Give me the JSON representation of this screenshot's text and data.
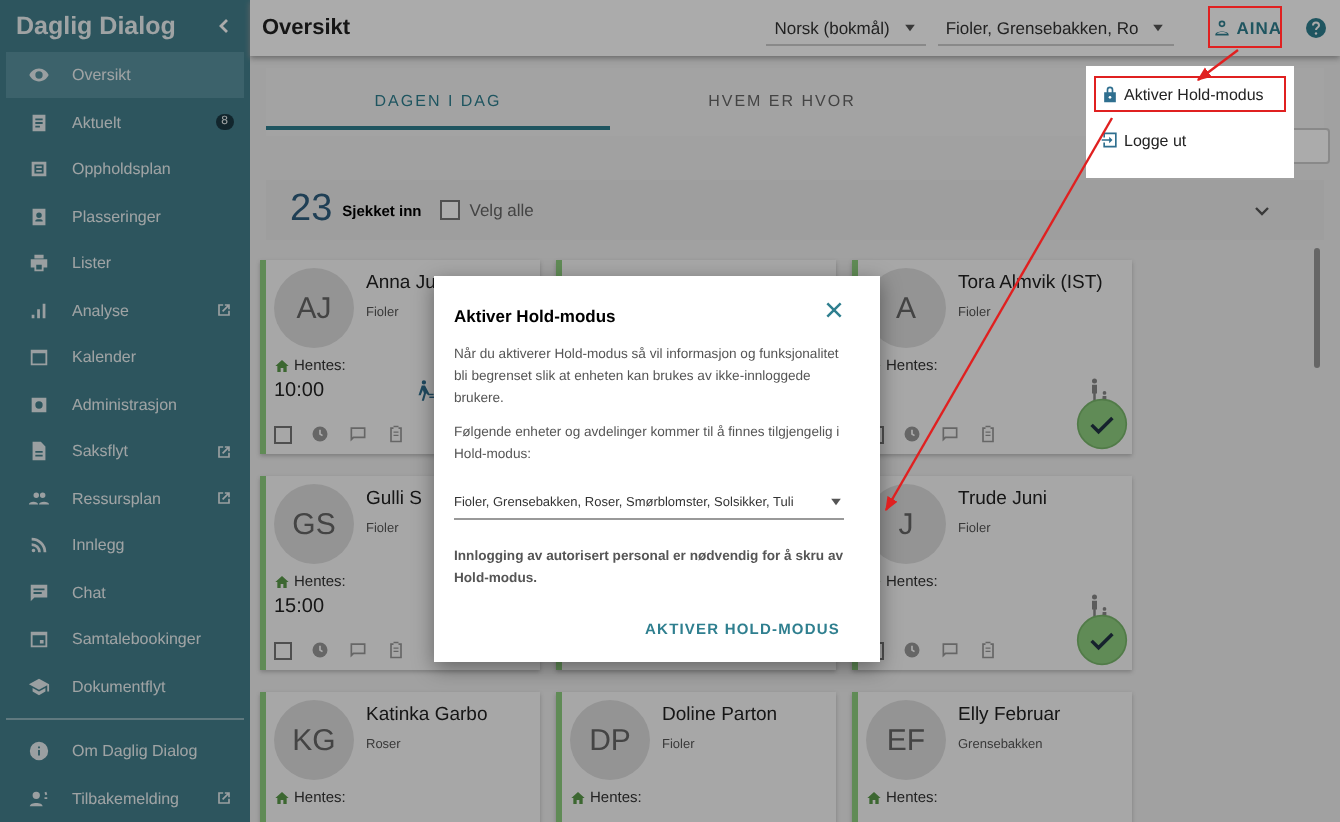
{
  "sidebar": {
    "title": "Daglig Dialog",
    "items": [
      {
        "label": "Oversikt",
        "selected": true,
        "external": false
      },
      {
        "label": "Aktuelt",
        "selected": false,
        "badge": "8",
        "external": false
      },
      {
        "label": "Oppholdsplan",
        "selected": false,
        "external": false
      },
      {
        "label": "Plasseringer",
        "selected": false,
        "external": false
      },
      {
        "label": "Lister",
        "selected": false,
        "external": false
      },
      {
        "label": "Analyse",
        "selected": false,
        "external": true
      },
      {
        "label": "Kalender",
        "selected": false,
        "external": false
      },
      {
        "label": "Administrasjon",
        "selected": false,
        "external": false
      },
      {
        "label": "Saksflyt",
        "selected": false,
        "external": true
      },
      {
        "label": "Ressursplan",
        "selected": false,
        "external": true
      },
      {
        "label": "Innlegg",
        "selected": false,
        "external": false
      },
      {
        "label": "Chat",
        "selected": false,
        "external": false
      },
      {
        "label": "Samtalebookinger",
        "selected": false,
        "external": false
      },
      {
        "label": "Dokumentflyt",
        "selected": false,
        "external": false
      }
    ],
    "footer_items": [
      {
        "label": "Om Daglig Dialog",
        "selected": false,
        "external": false
      },
      {
        "label": "Tilbakemelding",
        "selected": false,
        "external": true
      }
    ]
  },
  "topbar": {
    "title": "Oversikt",
    "selects": [
      {
        "value": "Norsk (bokmål)"
      },
      {
        "value": "Fioler, Grensebakken, Ro"
      }
    ],
    "user_button": "AINA"
  },
  "user_menu": [
    {
      "label": "Aktiver Hold-modus",
      "kind": "lock",
      "highlighted": true
    },
    {
      "label": "Logge ut",
      "kind": "logout",
      "highlighted": false
    }
  ],
  "tabs": [
    {
      "label": "DAGEN I DAG",
      "selected": true
    },
    {
      "label": "HVEM ER HVOR",
      "selected": false
    }
  ],
  "summary": {
    "count": "23",
    "label": "Sjekket inn",
    "select_all": {
      "label": "Velg alle",
      "checked": false
    }
  },
  "card_rows": [
    {
      "cards": [
        {
          "kind": "walking",
          "initials": "AJ",
          "name": "Anna Ju",
          "unit": "Fioler",
          "pickup": "Hentes:",
          "time": "10:00",
          "checked": false
        },
        {
          "kind": "escorted",
          "initials": "A",
          "name": "Tora Almvik (IST)",
          "unit": "Fioler",
          "pickup": "Hentes:",
          "check_button": true,
          "checked": false
        }
      ]
    },
    {
      "cards": [
        {
          "kind": "plain",
          "initials": "GS",
          "name": "Gulli S",
          "unit": "Fioler",
          "pickup": "Hentes:",
          "time": "15:00",
          "checked": false
        },
        {
          "kind": "escorted",
          "initials": "J",
          "name": "Trude Juni",
          "unit": "Fioler",
          "pickup": "Hentes:",
          "check_button": true,
          "checked": false
        }
      ]
    },
    {
      "cards": [
        {
          "kind": "plain",
          "initials": "KG",
          "name": "Katinka Garbo",
          "unit": "Roser",
          "pickup": "Hentes:"
        },
        {
          "kind": "plain",
          "initials": "DP",
          "name": "Doline Parton",
          "unit": "Fioler",
          "pickup": "Hentes:"
        },
        {
          "kind": "plain",
          "initials": "EF",
          "name": "Elly Februar",
          "unit": "Grensebakken",
          "pickup": "Hentes:"
        }
      ]
    }
  ],
  "dialog": {
    "title": "Aktiver Hold-modus",
    "paragraphs": [
      "Når du aktiverer Hold-modus så vil informasjon og funksjonalitet bli begrenset slik at enheten kan brukes av ikke-innloggede brukere.",
      "Følgende enheter og avdelinger kommer til å finnes tilgjengelig i Hold-modus:"
    ],
    "select": "Fioler, Grensebakken, Roser, Smørblomster, Solsikker, Tuli",
    "note": "Innlogging av autorisert personal er nødvendig for å skru av Hold-modus.",
    "button": "AKTIVER HOLD-MODUS"
  }
}
